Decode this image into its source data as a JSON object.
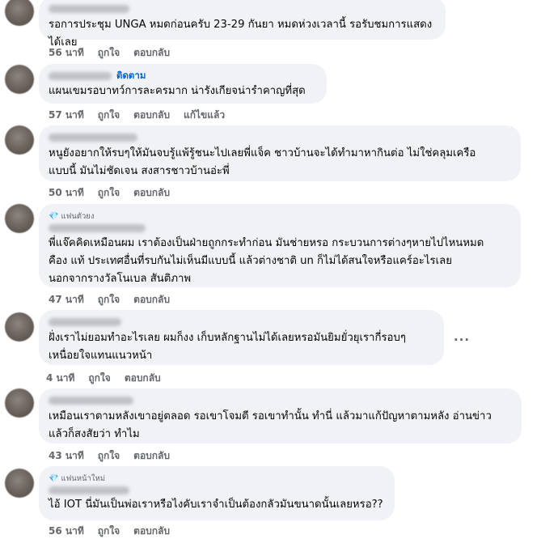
{
  "comments": [
    {
      "text": "รอการประชุม UNGA หมดก่อนครับ 23-29 กันยา หมดห่วงเวลานี้ รอรับชมการแสดงได้เลย",
      "time": "56 นาที",
      "like": "ถูกใจ",
      "reply": "ตอบกลับ"
    },
    {
      "follow": "ติดตาม",
      "text": "แผนเขมรอบาทว์การละครมาก น่ารังเกียจน่ารำคาญที่สุด",
      "time": "57 นาที",
      "like": "ถูกใจ",
      "reply": "ตอบกลับ",
      "edited": "แก้ไขแล้ว"
    },
    {
      "text": "หนูยังอยากให้รบๆให้มันจบรู้แพ้รู้ชนะไปเลยพี่แจ็ค ชาวบ้านจะได้ทำมาหากินต่อ ไม่ใช่คลุมเครือ\nแบบนี้ มันไม่ชัดเจน สงสารชาวบ้านอ่ะพี่",
      "time": "50 นาที",
      "like": "ถูกใจ",
      "reply": "ตอบกลับ"
    },
    {
      "badge": "แฟนตัวยง",
      "text": "พี่แจ๊คคิดเหมือนผม เราต้องเป็นฝ่ายถูกกระทำก่อน มันช่ายหรอ กระบวนการต่างๆหายไปไหนหมด\nคือง แท้ ประเทศอื่นที่รบกันไม่เห็นมีแบบนี้ แล้วต่างชาติ un ก็ไม่ได้สนใจหรือแคร์อะไรเลย\nนอกจากรางวัลโนเบล สันติภาพ",
      "time": "47 นาที",
      "like": "ถูกใจ",
      "reply": "ตอบกลับ"
    },
    {
      "text": "ฝั่งเราไม่ยอมทำอะไรเลย ผมก็งง เก็บหลักฐานไม่ได้เลยหรอมันยิมยั่วยุเรากี่รอบๆ\nเหนื่อยใจแทนแนวหน้า",
      "time": "4 นาที",
      "like": "ถูกใจ",
      "reply": "ตอบกลับ",
      "more": "···"
    },
    {
      "text": "เหมือนเราตามหลังเขาอยู่ตลอด รอเขาโจมตี รอเขาทำนั้น ทำนี่ แล้วมาแก้ปัญหาตามหลัง อ่านข่าว\nแล้วก็สงสัยว่า ทำไม",
      "time": "43 นาที",
      "like": "ถูกใจ",
      "reply": "ตอบกลับ"
    },
    {
      "badge": "แฟนหน้าใหม่",
      "text": "ไอ้ IOT นี่มันเป็นพ่อเราหรือไงคับเราจำเป็นต้องกลัวมันขนาดนั้นเลยหรอ??",
      "time": "56 นาที",
      "like": "ถูกใจ",
      "reply": "ตอบกลับ"
    }
  ]
}
